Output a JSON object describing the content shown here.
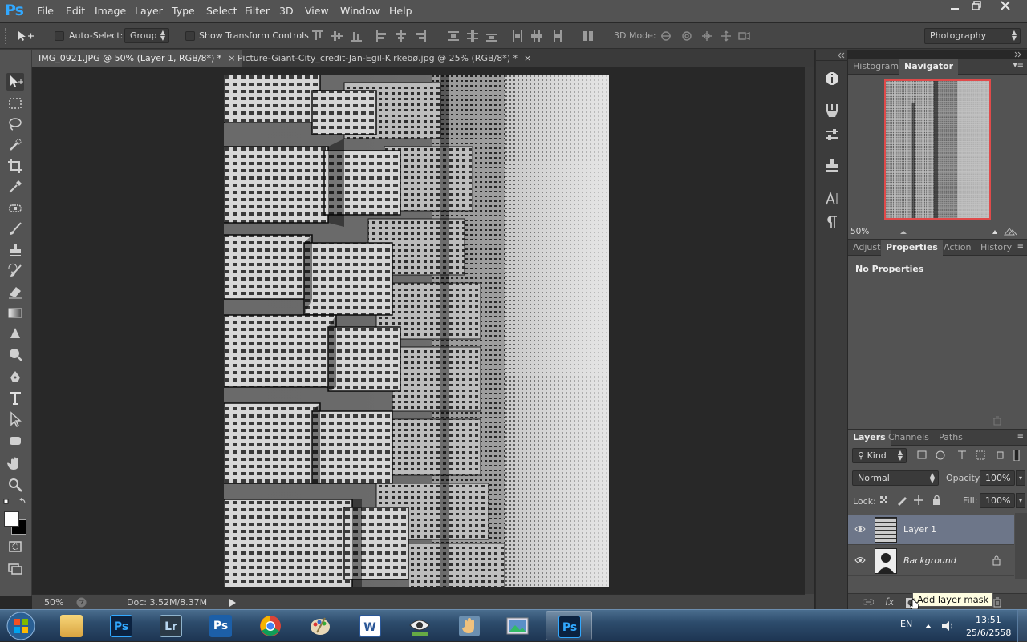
{
  "app": {
    "logo": "Ps"
  },
  "menu": [
    "File",
    "Edit",
    "Image",
    "Layer",
    "Type",
    "Select",
    "Filter",
    "3D",
    "View",
    "Window",
    "Help"
  ],
  "window_controls": [
    "minimize",
    "restore",
    "close"
  ],
  "options_bar": {
    "auto_select_label": "Auto-Select:",
    "auto_select_value": "Group",
    "transform_label": "Show Transform Controls",
    "mode_3d_label": "3D Mode:",
    "workspace": "Photography"
  },
  "doc_tabs": [
    {
      "title": "IMG_0921.JPG @ 50% (Layer 1, RGB/8*) *",
      "close": "×",
      "active": true
    },
    {
      "title": "Picture-Giant-City_credit-Jan-Egil-Kirkebø.jpg @ 25% (RGB/8*) *",
      "close": "×",
      "active": false
    }
  ],
  "status": {
    "zoom": "50%",
    "doc_info": "Doc: 3.52M/8.37M"
  },
  "navigator": {
    "tabs": [
      "Histogram",
      "Navigator"
    ],
    "zoom": "50%"
  },
  "properties": {
    "tabs": [
      "Adjustr",
      "Properties",
      "Action",
      "History"
    ],
    "content": "No Properties"
  },
  "layers_panel": {
    "tabs": [
      "Layers",
      "Channels",
      "Paths"
    ],
    "kind_label": "Kind",
    "blend_mode": "Normal",
    "opacity_label": "Opacity:",
    "opacity_value": "100%",
    "lock_label": "Lock:",
    "fill_label": "Fill:",
    "fill_value": "100%",
    "layers": [
      {
        "name": "Layer 1",
        "selected": true,
        "locked": false
      },
      {
        "name": "Background",
        "selected": false,
        "locked": true
      }
    ]
  },
  "tooltip": "Add layer mask",
  "taskbar": {
    "apps": [
      "Windows Explorer",
      "Photoshop",
      "Lightroom",
      "Photoshop",
      "Google Chrome",
      "Paint",
      "Word",
      "Viewer",
      "Hand tool",
      "Photo Viewer",
      "Photoshop"
    ],
    "lang": "EN",
    "time": "13:51",
    "date": "25/6/2558"
  },
  "colors": {
    "accent": "#31a8ff",
    "selected_layer": "#6d7689",
    "navigator_frame": "#e04a4a"
  }
}
